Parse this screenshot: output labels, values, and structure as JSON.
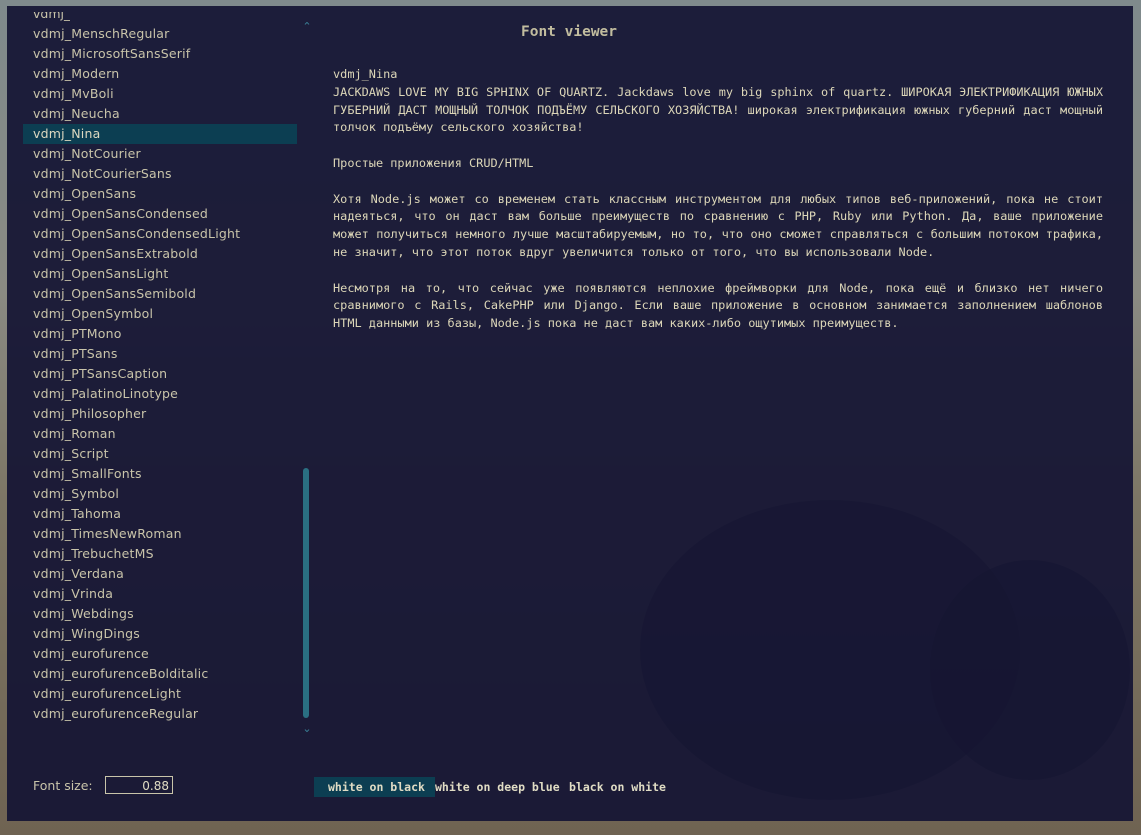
{
  "window": {
    "title": "Font viewer"
  },
  "font_list": {
    "partial_top_item": "vdmj_",
    "items": [
      "vdmj_MenschRegular",
      "vdmj_MicrosoftSansSerif",
      "vdmj_Modern",
      "vdmj_MvBoli",
      "vdmj_Neucha",
      "vdmj_Nina",
      "vdmj_NotCourier",
      "vdmj_NotCourierSans",
      "vdmj_OpenSans",
      "vdmj_OpenSansCondensed",
      "vdmj_OpenSansCondensedLight",
      "vdmj_OpenSansExtrabold",
      "vdmj_OpenSansLight",
      "vdmj_OpenSansSemibold",
      "vdmj_OpenSymbol",
      "vdmj_PTMono",
      "vdmj_PTSans",
      "vdmj_PTSansCaption",
      "vdmj_PalatinoLinotype",
      "vdmj_Philosopher",
      "vdmj_Roman",
      "vdmj_Script",
      "vdmj_SmallFonts",
      "vdmj_Symbol",
      "vdmj_Tahoma",
      "vdmj_TimesNewRoman",
      "vdmj_TrebuchetMS",
      "vdmj_Verdana",
      "vdmj_Vrinda",
      "vdmj_Webdings",
      "vdmj_WingDings",
      "vdmj_eurofurence",
      "vdmj_eurofurenceBolditalic",
      "vdmj_eurofurenceLight",
      "vdmj_eurofurenceRegular"
    ],
    "selected_index": 5,
    "scroll_fraction": 0.65
  },
  "preview": {
    "font_name": "vdmj_Nina",
    "pangram": "JACKDAWS LOVE MY BIG SPHINX OF QUARTZ. Jackdaws love my big sphinx of quartz. ШИРОКАЯ ЭЛЕКТРИФИКАЦИЯ ЮЖНЫХ ГУБЕРНИЙ ДАСТ МОЩНЫЙ ТОЛЧОК ПОДЪЁМУ СЕЛЬСКОГО ХОЗЯЙСТВА! широкая электрификация южных губерний даст мощный толчок подъёму сельского хозяйства!",
    "heading": "Простые приложения CRUD/HTML",
    "paragraph1": "Хотя Node.js может со временем стать классным инструментом для любых типов веб-приложений, пока не стоит надеяться, что он даст вам больше преимуществ по сравнению с PHP, Ruby или Python. Да, ваше приложение может получиться немного лучше масштабируемым, но то, что оно сможет справляться с большим потоком трафика, не значит, что этот поток вдруг увеличится только от того, что вы использовали Node.",
    "paragraph2": "Несмотря на то, что сейчас уже появляются неплохие фреймворки для Node, пока ещё и близко нет ничего сравнимого с Rails, CakePHP или Django. Если ваше приложение в основном занимается заполнением шаблонов HTML данными из базы, Node.js пока не даст вам каких-либо ощутимых преимуществ."
  },
  "font_size": {
    "label": "Font size:",
    "value": "0.88"
  },
  "themes": {
    "selected_index": 0,
    "options": [
      "white on black",
      "white on deep blue",
      "black on white"
    ]
  },
  "icons": {
    "scroll_up": "chevron-up-icon",
    "scroll_down": "chevron-down-icon"
  },
  "colors": {
    "panel": "#141434",
    "text": "#c9c4aa",
    "selection": "#0c3e52",
    "scrollbar": "#2a6f82"
  }
}
